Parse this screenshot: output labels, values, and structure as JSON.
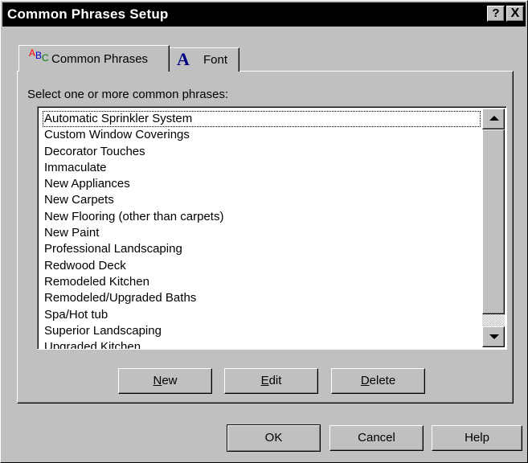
{
  "window": {
    "title": "Common Phrases Setup",
    "help_button": "?",
    "close_button": "X"
  },
  "tabs": [
    {
      "label": "Common Phrases",
      "icon": "abc-text-icon",
      "selected": true
    },
    {
      "label": "Font",
      "icon": "font-a-icon",
      "selected": false
    }
  ],
  "prompt": "Select one or more common phrases:",
  "phrases": [
    "Automatic Sprinkler System",
    "Custom Window Coverings",
    "Decorator Touches",
    "Immaculate",
    "New Appliances",
    "New Carpets",
    "New Flooring (other than carpets)",
    "New Paint",
    "Professional Landscaping",
    "Redwood Deck",
    "Remodeled Kitchen",
    "Remodeled/Upgraded Baths",
    "Spa/Hot tub",
    "Superior Landscaping",
    "Upgraded Kitchen"
  ],
  "list_buttons": {
    "new_rest": "ew",
    "new_key": "N",
    "edit_key": "E",
    "edit_rest": "dit",
    "delete_key": "D",
    "delete_rest": "elete"
  },
  "dialog_buttons": {
    "ok": "OK",
    "cancel": "Cancel",
    "help": "Help"
  },
  "colors": {
    "titlebar": "#000000",
    "face": "#c0c0c0",
    "list_bg": "#ffffff"
  }
}
